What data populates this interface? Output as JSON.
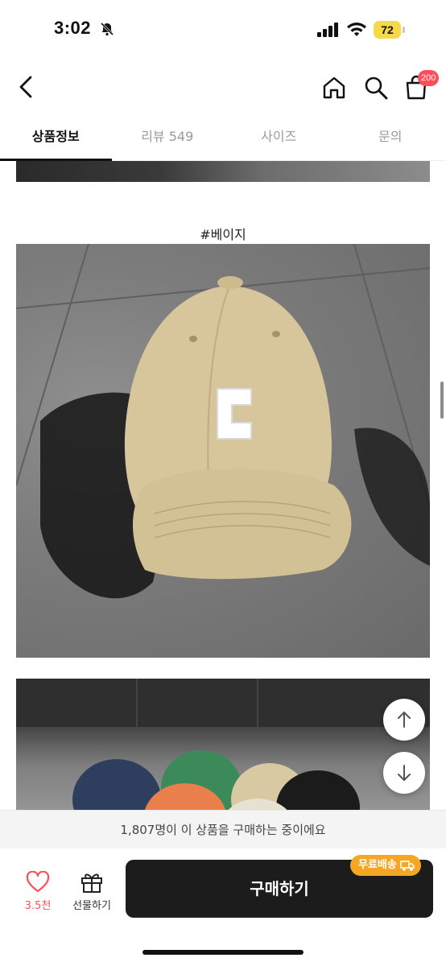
{
  "status_bar": {
    "time": "3:02",
    "battery": "72"
  },
  "header": {
    "cart_count": "200"
  },
  "tabs": [
    {
      "label": "상품정보",
      "active": true
    },
    {
      "label": "리뷰 549",
      "active": false
    },
    {
      "label": "사이즈",
      "active": false
    },
    {
      "label": "문의",
      "active": false
    }
  ],
  "content": {
    "color_caption": "#베이지"
  },
  "buyers_text": "1,807명이 이 상품을 구매하는 중이에요",
  "bottom_bar": {
    "like_count": "3.5천",
    "gift_label": "선물하기",
    "buy_label": "구매하기",
    "shipping_tag": "무료배송"
  },
  "colors": {
    "accent_red": "#ff4d5a",
    "shipping_orange": "#f5a623",
    "buy_button": "#1c1c1c"
  }
}
